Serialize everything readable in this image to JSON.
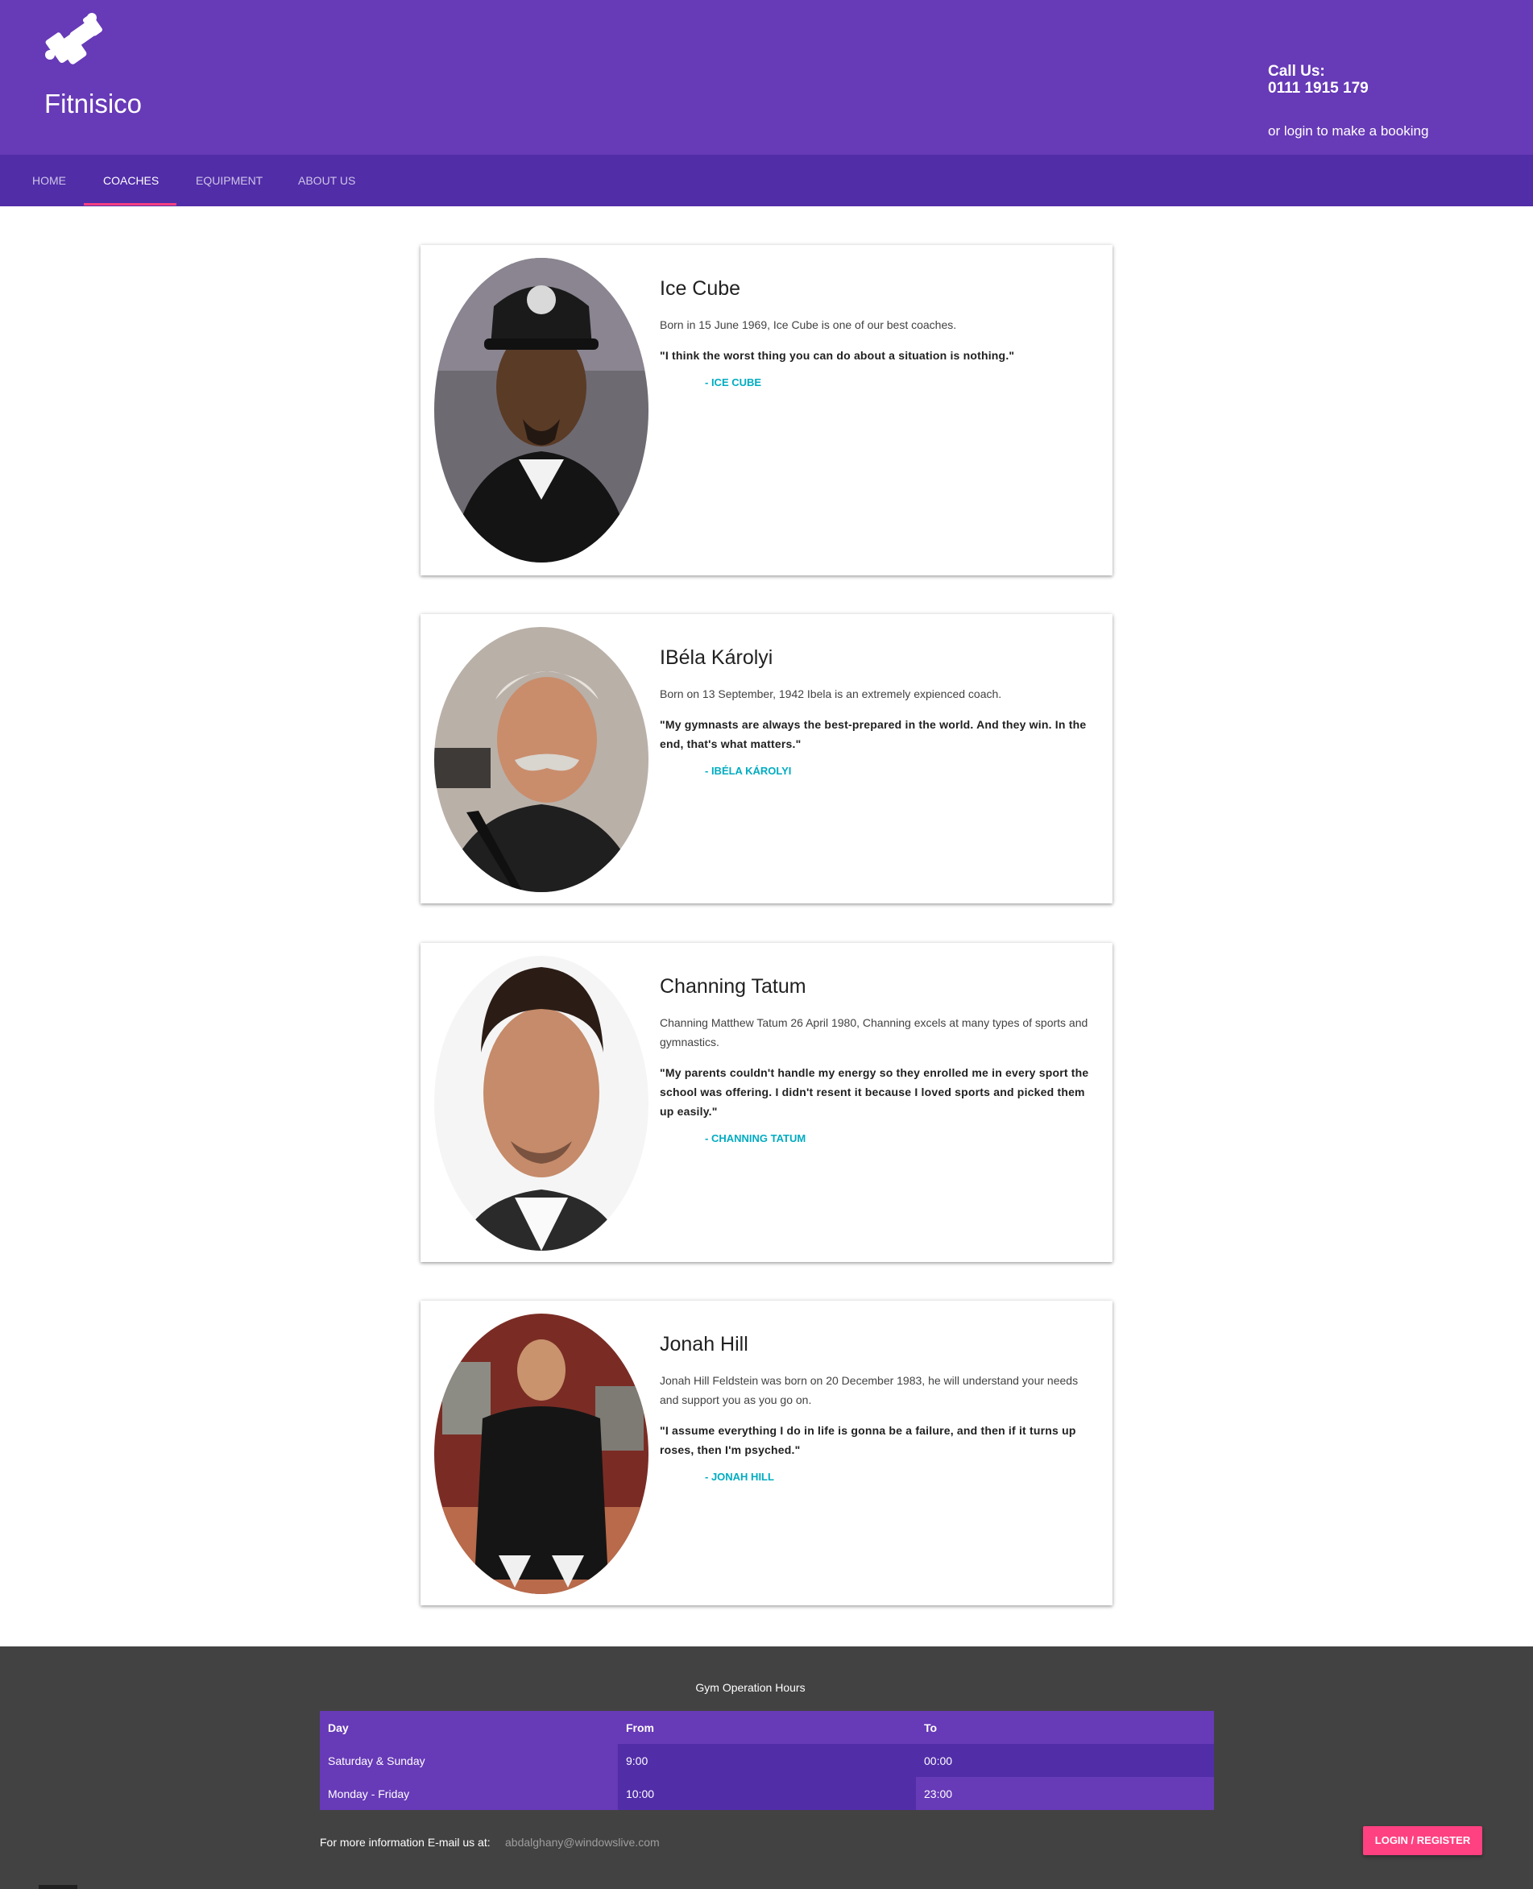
{
  "header": {
    "brand": "Fitnisico",
    "call_label": "Call Us:",
    "phone": "0111 1915 179",
    "login_hint": "or login to make a booking"
  },
  "nav": {
    "items": [
      {
        "label": "HOME",
        "active": false
      },
      {
        "label": "COACHES",
        "active": true
      },
      {
        "label": "EQUIPMENT",
        "active": false
      },
      {
        "label": "ABOUT US",
        "active": false
      }
    ]
  },
  "coaches": [
    {
      "name": "Ice Cube",
      "bio": "Born in 15 June 1969, Ice Cube is one of our best coaches.",
      "quote": "\"I think the worst thing you can do about a situation is nothing.\"",
      "author": "- ICE CUBE"
    },
    {
      "name": "IBéla Károlyi",
      "bio": "Born on 13 September, 1942 Ibela is an extremely expienced coach.",
      "quote": "\"My gymnasts are always the best-prepared in the world. And they win. In the end, that's what matters.\"",
      "author": "- IBÉLA KÁROLYI"
    },
    {
      "name": "Channing Tatum",
      "bio": "Channing Matthew Tatum 26 April 1980, Channing excels at many types of sports and gymnastics.",
      "quote": "\"My parents couldn't handle my energy so they enrolled me in every sport the school was offering. I didn't resent it because I loved sports and picked them up easily.\"",
      "author": "- CHANNING TATUM"
    },
    {
      "name": "Jonah Hill",
      "bio": "Jonah Hill Feldstein was born on 20 December 1983, he will understand your needs and support you as you go on.",
      "quote": "\"I assume everything I do in life is gonna be a failure, and then if it turns up roses, then I'm psyched.\"",
      "author": "- JONAH HILL"
    }
  ],
  "footer": {
    "title": "Gym Operation Hours",
    "columns": [
      "Day",
      "From",
      "To"
    ],
    "rows": [
      [
        "Saturday & Sunday",
        "9:00",
        "00:00"
      ],
      [
        "Monday - Friday",
        "10:00",
        "23:00"
      ]
    ],
    "email_label": "For more information E-mail us at:",
    "email": "abdalghany@windowslive.com",
    "login_button": "LOGIN / REGISTER"
  },
  "colors": {
    "primary": "#673ab7",
    "primary_dark": "#512da8",
    "accent": "#ff4081",
    "author": "#00acc1",
    "footer_bg": "#424242"
  }
}
